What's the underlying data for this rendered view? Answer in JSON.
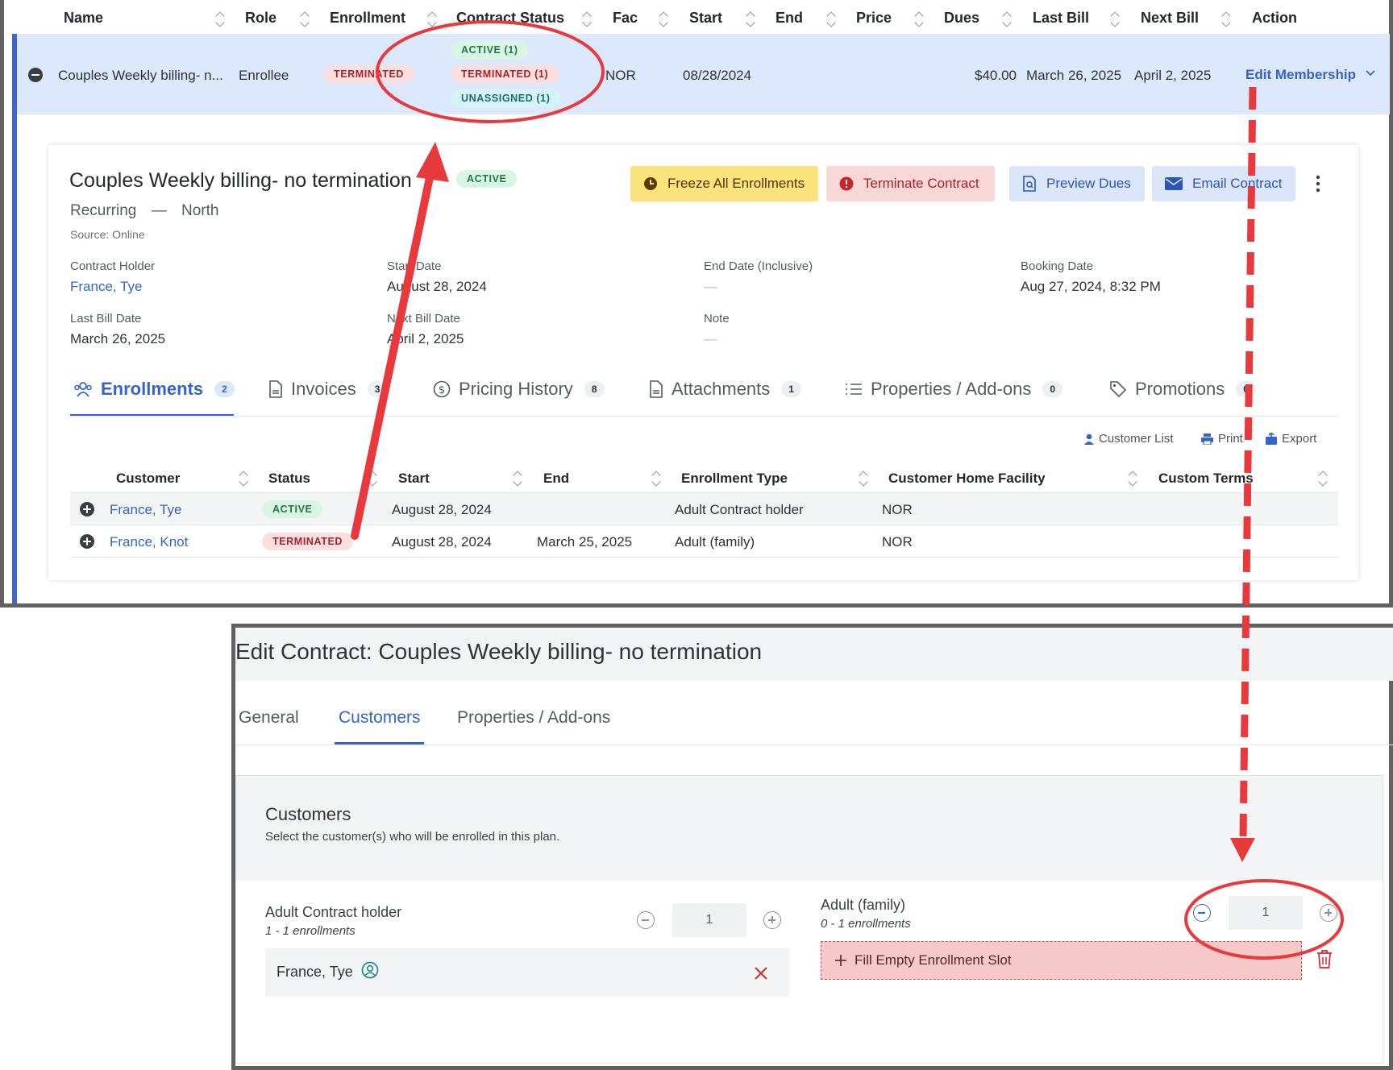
{
  "table": {
    "headers": [
      "Name",
      "Role",
      "Enrollment",
      "Contract Status",
      "Fac",
      "Start",
      "End",
      "Price",
      "Dues",
      "Last Bill",
      "Next Bill",
      "Action"
    ],
    "row": {
      "name": "Couples Weekly billing- n...",
      "role": "Enrollee",
      "enrollment_badge": "TERMINATED",
      "status_badges": [
        "ACTIVE (1)",
        "TERMINATED (1)",
        "UNASSIGNED (1)"
      ],
      "facility": "NOR",
      "start": "08/28/2024",
      "end": "",
      "price": "",
      "dues": "$40.00",
      "last_bill": "March 26, 2025",
      "next_bill": "April 2, 2025",
      "action": "Edit Membership"
    }
  },
  "detail": {
    "title": "Couples Weekly billing- no termination",
    "status_badge": "ACTIVE",
    "billing_type": "Recurring",
    "separator": "—",
    "facility_name": "North",
    "source": "Source: Online",
    "buttons": {
      "freeze": "Freeze All Enrollments",
      "terminate": "Terminate Contract",
      "preview": "Preview Dues",
      "email": "Email Contract"
    },
    "fields": {
      "contract_holder_label": "Contract Holder",
      "contract_holder": "France, Tye",
      "start_date_label": "Start Date",
      "start_date": "August 28, 2024",
      "end_date_label": "End Date (Inclusive)",
      "end_date": "—",
      "booking_date_label": "Booking Date",
      "booking_date": "Aug 27, 2024, 8:32 PM",
      "last_bill_label": "Last Bill Date",
      "last_bill": "March 26, 2025",
      "next_bill_label": "Next Bill Date",
      "next_bill": "April 2, 2025",
      "note_label": "Note",
      "note": "—"
    },
    "tabs": [
      {
        "label": "Enrollments",
        "count": "2"
      },
      {
        "label": "Invoices",
        "count": "3"
      },
      {
        "label": "Pricing History",
        "count": "8"
      },
      {
        "label": "Attachments",
        "count": "1"
      },
      {
        "label": "Properties / Add-ons",
        "count": "0"
      },
      {
        "label": "Promotions",
        "count": "0"
      }
    ],
    "tools": {
      "customer_list": "Customer List",
      "print": "Print",
      "export": "Export"
    },
    "enroll_headers": [
      "Customer",
      "Status",
      "Start",
      "End",
      "Enrollment Type",
      "Customer Home Facility",
      "Custom Terms"
    ],
    "enrollments": [
      {
        "customer": "France, Tye",
        "status": "ACTIVE",
        "start": "August 28, 2024",
        "end": "",
        "type": "Adult Contract holder",
        "facility": "NOR"
      },
      {
        "customer": "France, Knot",
        "status": "TERMINATED",
        "start": "August 28, 2024",
        "end": "March 25, 2025",
        "type": "Adult (family)",
        "facility": "NOR"
      }
    ]
  },
  "edit": {
    "title": "Edit Contract: Couples Weekly billing- no termination",
    "tabs": [
      "General",
      "Customers",
      "Properties / Add-ons"
    ],
    "section_title": "Customers",
    "section_subtitle": "Select the customer(s) who will be enrolled in this plan.",
    "slot1": {
      "name": "Adult Contract holder",
      "range": "1 - 1 enrollments",
      "count": "1",
      "customer": "France, Tye"
    },
    "slot2": {
      "name": "Adult (family)",
      "range": "0 - 1 enrollments",
      "count": "1",
      "fill_label": "Fill Empty Enrollment Slot"
    }
  },
  "colors": {
    "accent": "#3463c9",
    "annotation": "#e8393d",
    "freeze_bg": "#fbe27a",
    "terminate_bg": "#fad7d7",
    "preview_bg": "#dbe6fa"
  }
}
